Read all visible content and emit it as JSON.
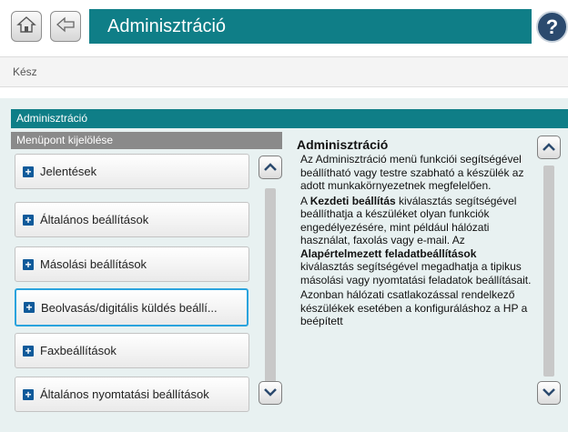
{
  "header": {
    "title": "Adminisztráció",
    "home_icon": "home-icon",
    "back_icon": "back-icon",
    "help_label": "?"
  },
  "status": {
    "text": "Kész"
  },
  "panel": {
    "title": "Adminisztráció",
    "left_header": "Menüpont kijelölése"
  },
  "menu": {
    "items": [
      {
        "label": "Jelentések"
      },
      {
        "label": "Általános beállítások"
      },
      {
        "label": "Másolási beállítások"
      },
      {
        "label": "Beolvasás/digitális küldés beállí..."
      },
      {
        "label": "Faxbeállítások"
      },
      {
        "label": "Általános nyomtatási beállítások"
      }
    ],
    "selected_index": 3
  },
  "description": {
    "title": "Adminisztráció",
    "p1": "Az Adminisztráció menü funkciói segítségével beállítható vagy testre szabható a készülék az adott munkakörnyezetnek megfelelően.",
    "p2_a": "A ",
    "p2_bold1": "Kezdeti beállítás",
    "p2_b": " kiválasztás segítségével beállíthatja a készüléket olyan funkciók engedélyezésére, mint például hálózati használat, faxolás vagy e-mail. Az ",
    "p2_bold2": "Alapértelmezett feladatbeállítások",
    "p2_c": " kiválasztás segítségével megadhatja a tipikus másolási vagy nyomtatási feladatok beállításait.",
    "p3": "Azonban hálózati csatlakozással rendelkező készülékek esetében a konfiguráláshoz a HP a beépített"
  },
  "colors": {
    "accent": "#0f7e87",
    "selection": "#2aa3dd",
    "plus_icon": "#0f5a9a"
  }
}
